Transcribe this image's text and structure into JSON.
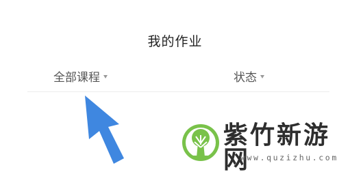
{
  "header": {
    "title": "我的作业"
  },
  "filters": {
    "course_label": "全部课程",
    "status_label": "状态",
    "caret_icon": "caret-down-icon"
  },
  "overlay": {
    "arrow_icon": "pointer-arrow-icon",
    "arrow_color": "#3f87e0"
  },
  "watermark": {
    "name": "紫竹新游网",
    "url": "www.quzizhu.com",
    "logo_icon": "tree-logo-icon",
    "logo_color": "#79c24a"
  }
}
